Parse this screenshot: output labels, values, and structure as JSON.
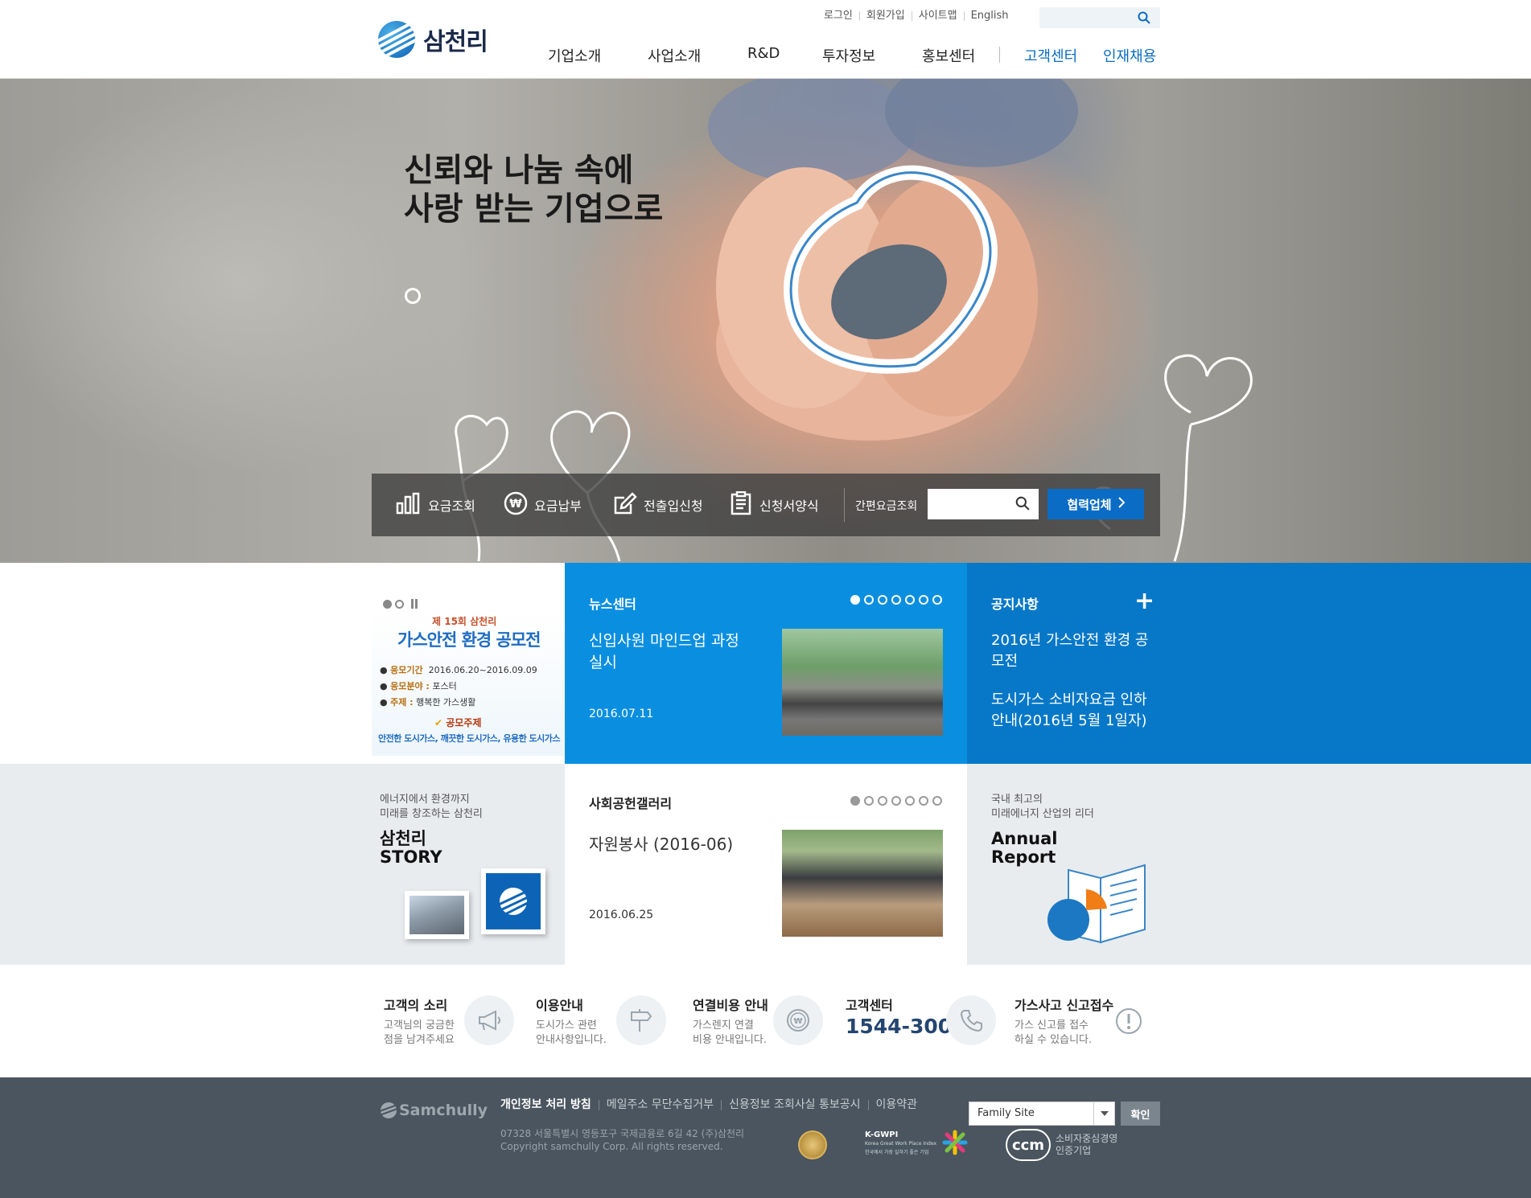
{
  "header": {
    "logo_text": "삼천리",
    "util_links": [
      "로그인",
      "회원가입",
      "사이트맵",
      "English"
    ],
    "search_placeholder": "",
    "nav": [
      "기업소개",
      "사업소개",
      "R&D",
      "투자정보",
      "홍보센터"
    ],
    "nav_highlight": [
      "고객센터",
      "인재채용"
    ]
  },
  "hero": {
    "title_line1": "신뢰와 나눔 속에",
    "title_line2": "사랑 받는 기업으로",
    "quick": [
      {
        "label": "요금조회",
        "icon": "bar-chart-icon"
      },
      {
        "label": "요금납부",
        "icon": "won-coin-icon"
      },
      {
        "label": "전출입신청",
        "icon": "edit-icon"
      },
      {
        "label": "신청서양식",
        "icon": "document-icon"
      }
    ],
    "simple_fee_label": "간편요금조회",
    "simple_fee_value": "",
    "partner_label": "협력업체"
  },
  "banner": {
    "line1": "제 15회 삼천리",
    "line2": "가스안전 환경 공모전",
    "rows": [
      {
        "label": "응모기간",
        "value": "2016.06.20~2016.09.09"
      },
      {
        "label": "응모분야 :",
        "value": "포스터"
      },
      {
        "label": "주제 :",
        "value": "행복한 가스생활"
      }
    ],
    "theme_label": "공모주제",
    "theme_text": "안전한 도시가스, 깨끗한 도시가스, 유용한 도시가스"
  },
  "news": {
    "title": "뉴스센터",
    "headline": "신입사원 마인드업 과정 실시",
    "date": "2016.07.11",
    "page_count": 7
  },
  "notice": {
    "title": "공지사항",
    "items": [
      "2016년 가스안전 환경 공모전",
      "도시가스 소비자요금 인하 안내(2016년 5월 1일자)"
    ]
  },
  "story": {
    "sub1": "에너지에서 환경까지",
    "sub2": "미래를 창조하는 삼천리",
    "title1": "삼천리",
    "title2": "STORY"
  },
  "gallery": {
    "title": "사회공헌갤러리",
    "headline": "자원봉사 (2016-06)",
    "date": "2016.06.25",
    "page_count": 7
  },
  "annual": {
    "sub1": "국내 최고의",
    "sub2": "미래에너지 산업의 리더",
    "title1": "Annual",
    "title2": "Report"
  },
  "services": [
    {
      "title": "고객의 소리",
      "desc1": "고객님의 궁금한",
      "desc2": "점을 남겨주세요",
      "icon": "megaphone-icon"
    },
    {
      "title": "이용안내",
      "desc1": "도시가스 관련",
      "desc2": "안내사항입니다.",
      "icon": "signpost-icon"
    },
    {
      "title": "연결비용 안내",
      "desc1": "가스렌지 연결",
      "desc2": "비용 안내입니다.",
      "icon": "won-coin-icon"
    },
    {
      "title": "고객센터",
      "phone": "1544-3002",
      "icon": "phone-icon"
    },
    {
      "title": "가스사고 신고접수",
      "desc1": "가스 신고를 접수",
      "desc2": "하실 수 있습니다.",
      "icon": "alert-icon"
    }
  ],
  "footer": {
    "logo_text": "Samchully",
    "links": [
      "개인정보 처리 방침",
      "메일주소 무단수집거부",
      "신용정보 조회사실 통보공시",
      "이용약관"
    ],
    "address": "07328 서울특별시 영등포구 국제금융로 6길 42 (주)삼천리",
    "copyright": "Copyright samchully Corp. All rights reserved.",
    "family_site": "Family Site",
    "ok_label": "확인",
    "cert_kgwpi": "K-GWPI",
    "cert_kgwpi_sub": "Korea Great Work Place Index",
    "cert_kgwpi_sub2": "한국에서 가장 일하기 좋은 기업",
    "cert_ccm": "ccm",
    "cert_ccm_line1": "소비자중심경영",
    "cert_ccm_line2": "인증기업"
  },
  "colors": {
    "brand_blue": "#0a6cc4",
    "news_blue": "#0a8fe0",
    "notice_blue": "#0778c8",
    "footer_bg": "#4a555f"
  }
}
